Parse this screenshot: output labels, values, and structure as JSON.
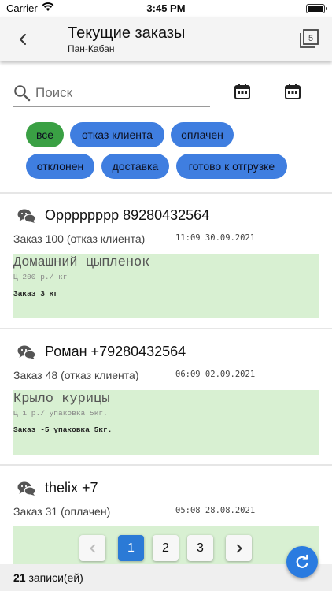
{
  "status_bar": {
    "carrier": "Carrier",
    "time": "3:45 PM"
  },
  "header": {
    "title": "Текущие заказы",
    "subtitle": "Пан-Кабан"
  },
  "search": {
    "placeholder": "Поиск",
    "value": ""
  },
  "chips": [
    {
      "label": "все",
      "active": true
    },
    {
      "label": "отказ клиента",
      "active": false
    },
    {
      "label": "оплачен",
      "active": false
    },
    {
      "label": "отклонен",
      "active": false
    },
    {
      "label": "доставка",
      "active": false
    },
    {
      "label": "готово к отгрузке",
      "active": false
    }
  ],
  "orders": [
    {
      "customer": "Opppppppp 89280432564",
      "order": "Заказ 100 (отказ клиента)",
      "date": "11:09 30.09.2021",
      "item": {
        "name": "Домашний цыпленок",
        "price": "Ц 200 р./ кг",
        "qty": "Заказ 3 кг"
      }
    },
    {
      "customer": "Роман +79280432564",
      "order": "Заказ 48 (отказ клиента)",
      "date": "06:09 02.09.2021",
      "item": {
        "name": "Крыло курицы",
        "price": "Ц 1 р./ упаковка 5кг.",
        "qty": "Заказ -5 упаковка 5кг."
      }
    },
    {
      "customer": "thelix +7",
      "order": "Заказ 31 (оплачен)",
      "date": "05:08 28.08.2021"
    }
  ],
  "pagination": {
    "pages": [
      "1",
      "2",
      "3"
    ],
    "current": "1"
  },
  "footer": {
    "count": "21",
    "label": "записи(ей)"
  },
  "colors": {
    "chip": "#3f7ee0",
    "chip_active": "#3aa044",
    "item_bg": "#d8f0d2",
    "accent": "#2b7ad6"
  },
  "icons": [
    "back-arrow-icon",
    "filter-5-icon",
    "search-icon",
    "calendar-icon",
    "chat-icon",
    "chevron-left-icon",
    "chevron-right-icon",
    "refresh-icon",
    "wifi-icon"
  ]
}
